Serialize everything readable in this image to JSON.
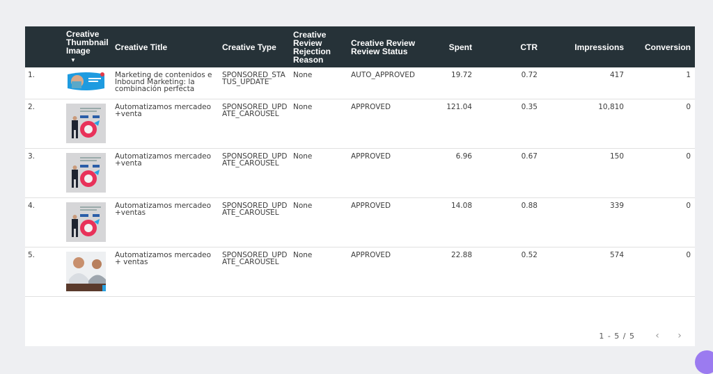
{
  "table": {
    "columns": [
      {
        "key": "index",
        "label": ""
      },
      {
        "key": "thumbnail",
        "label": "Creative Thumbnail Image",
        "sorted": "descending"
      },
      {
        "key": "title",
        "label": "Creative Title"
      },
      {
        "key": "type",
        "label": "Creative Type"
      },
      {
        "key": "rejection",
        "label": "Creative Review Rejection Reason"
      },
      {
        "key": "status",
        "label": "Creative Review Review Status"
      },
      {
        "key": "spent",
        "label": "Spent"
      },
      {
        "key": "ctr",
        "label": "CTR"
      },
      {
        "key": "impressions",
        "label": "Impressions"
      },
      {
        "key": "conversion",
        "label": "Conversion"
      }
    ],
    "sort_icon": "sort-descending-icon",
    "rows": [
      {
        "index": "1.",
        "thumbnail": "content-marketing-banner",
        "title": "Marketing de contenidos e Inbound Marketing: la combinación perfecta",
        "type": "SPONSORED_STATUS_UPDATE",
        "rejection": "None",
        "status": "AUTO_APPROVED",
        "spent": "19.72",
        "ctr": "0.72",
        "impressions": "417",
        "conversion": "1"
      },
      {
        "index": "2.",
        "thumbnail": "man-with-laptop-chart",
        "title": "Automatizamos mercadeo +venta",
        "type": "SPONSORED_UPDATE_CAROUSEL",
        "rejection": "None",
        "status": "APPROVED",
        "spent": "121.04",
        "ctr": "0.35",
        "impressions": "10,810",
        "conversion": "0"
      },
      {
        "index": "3.",
        "thumbnail": "man-with-laptop-chart",
        "title": "Automatizamos mercadeo +venta",
        "type": "SPONSORED_UPDATE_CAROUSEL",
        "rejection": "None",
        "status": "APPROVED",
        "spent": "6.96",
        "ctr": "0.67",
        "impressions": "150",
        "conversion": "0"
      },
      {
        "index": "4.",
        "thumbnail": "man-with-laptop-chart",
        "title": "Automatizamos mercadeo +ventas",
        "type": "SPONSORED_UPDATE_CAROUSEL",
        "rejection": "None",
        "status": "APPROVED",
        "spent": "14.08",
        "ctr": "0.88",
        "impressions": "339",
        "conversion": "0"
      },
      {
        "index": "5.",
        "thumbnail": "two-men-at-desk-photo",
        "title": "Automatizamos mercadeo + ventas",
        "type": "SPONSORED_UPDATE_CAROUSEL",
        "rejection": "None",
        "status": "APPROVED",
        "spent": "22.88",
        "ctr": "0.52",
        "impressions": "574",
        "conversion": "0"
      }
    ]
  },
  "pagination": {
    "range": "1 - 5 / 5",
    "prev_icon": "chevron-left-icon",
    "next_icon": "chevron-right-icon",
    "prev_glyph": "‹",
    "next_glyph": "›"
  },
  "colors": {
    "header_bg": "#263238",
    "page_bg": "#eeeff2",
    "fab": "#9b7bf0"
  }
}
